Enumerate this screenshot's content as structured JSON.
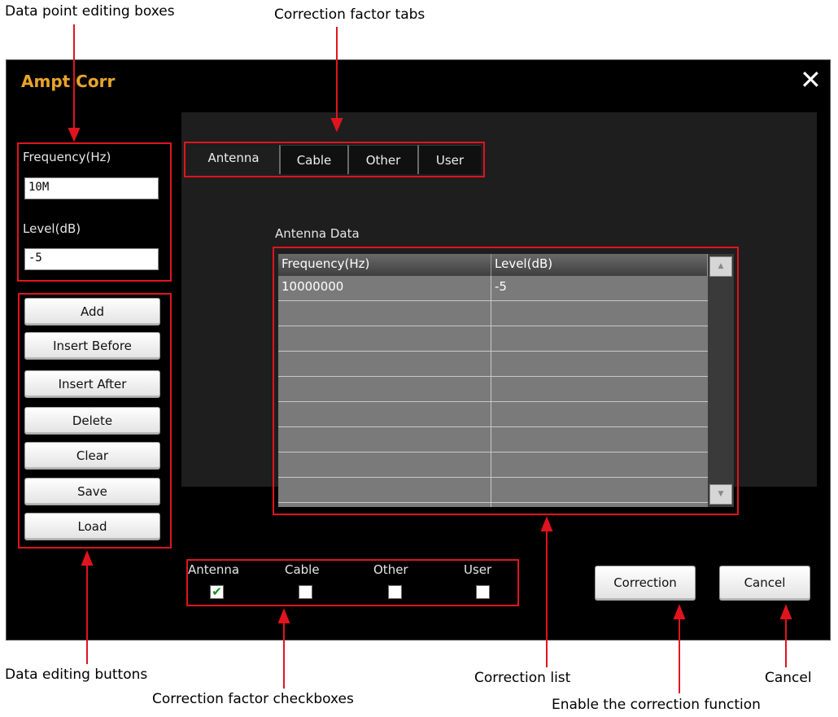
{
  "annotations": {
    "data_point_boxes": "Data point editing boxes",
    "correction_tabs": "Correction factor tabs",
    "data_editing_buttons": "Data editing buttons",
    "correction_checkboxes": "Correction factor checkboxes",
    "correction_list": "Correction list",
    "enable_correction": "Enable the correction function",
    "cancel": "Cancel"
  },
  "dialog": {
    "title": "Ampt Corr",
    "close_symbol": "✕"
  },
  "fields": {
    "frequency_label": "Frequency(Hz)",
    "frequency_value": "10M",
    "level_label": "Level(dB)",
    "level_value": "-5"
  },
  "buttons": {
    "add": "Add",
    "insert_before": "Insert Before",
    "insert_after": "Insert After",
    "delete": "Delete",
    "clear": "Clear",
    "save": "Save",
    "load": "Load",
    "correction": "Correction",
    "cancel": "Cancel"
  },
  "tabs": [
    {
      "label": "Antenna",
      "active": true
    },
    {
      "label": "Cable",
      "active": false
    },
    {
      "label": "Other",
      "active": false
    },
    {
      "label": "User",
      "active": false
    }
  ],
  "table": {
    "title": "Antenna Data",
    "headers": [
      "Frequency(Hz)",
      "Level(dB)"
    ],
    "rows": [
      [
        "10000000",
        "-5"
      ]
    ]
  },
  "checkboxes": [
    {
      "label": "Antenna",
      "checked": true
    },
    {
      "label": "Cable",
      "checked": false
    },
    {
      "label": "Other",
      "checked": false
    },
    {
      "label": "User",
      "checked": false
    }
  ],
  "colors": {
    "title": "#e8a52a",
    "annotation": "#e0141e",
    "check": "#1a8a1a"
  }
}
